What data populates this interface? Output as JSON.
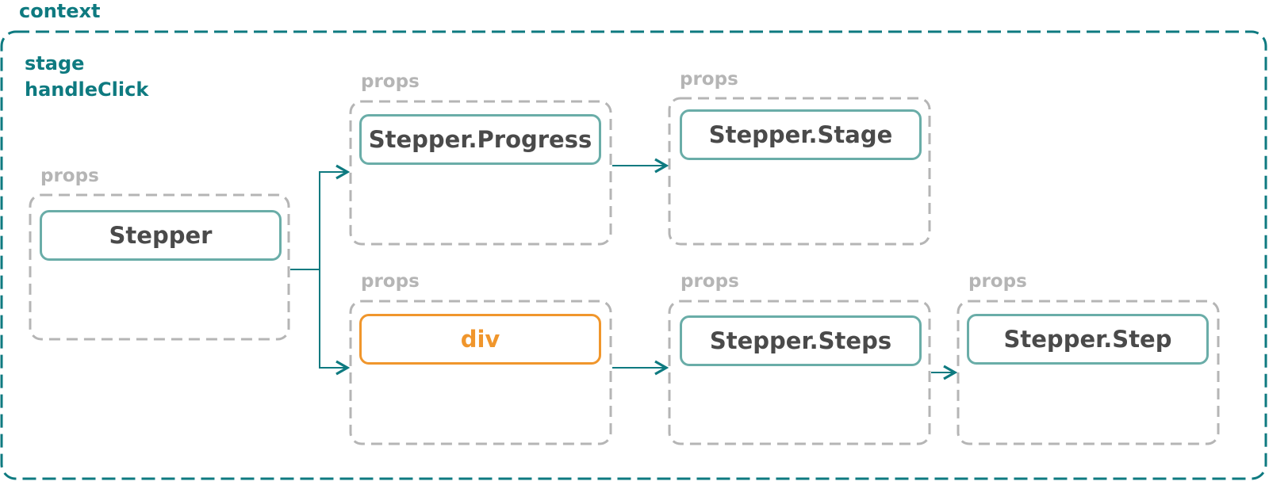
{
  "context": {
    "label": "context",
    "variables": [
      "stage",
      "handleClick"
    ]
  },
  "colors": {
    "context": "#0e7a80",
    "props_border": "#b5b5b5",
    "component_border": "#6aada8",
    "html_element": "#f0962c",
    "component_text": "#4a4a4a"
  },
  "nodes": [
    {
      "id": "stepper",
      "props_label": "props",
      "name": "Stepper",
      "kind": "component"
    },
    {
      "id": "progress",
      "props_label": "props",
      "name": "Stepper.Progress",
      "kind": "component"
    },
    {
      "id": "stage",
      "props_label": "props",
      "name": "Stepper.Stage",
      "kind": "component"
    },
    {
      "id": "div",
      "props_label": "props",
      "name": "div",
      "kind": "html"
    },
    {
      "id": "steps",
      "props_label": "props",
      "name": "Stepper.Steps",
      "kind": "component"
    },
    {
      "id": "step",
      "props_label": "props",
      "name": "Stepper.Step",
      "kind": "component"
    }
  ],
  "edges": [
    {
      "from": "stepper",
      "to": "progress"
    },
    {
      "from": "stepper",
      "to": "div"
    },
    {
      "from": "progress",
      "to": "stage"
    },
    {
      "from": "div",
      "to": "steps"
    },
    {
      "from": "steps",
      "to": "step"
    }
  ]
}
